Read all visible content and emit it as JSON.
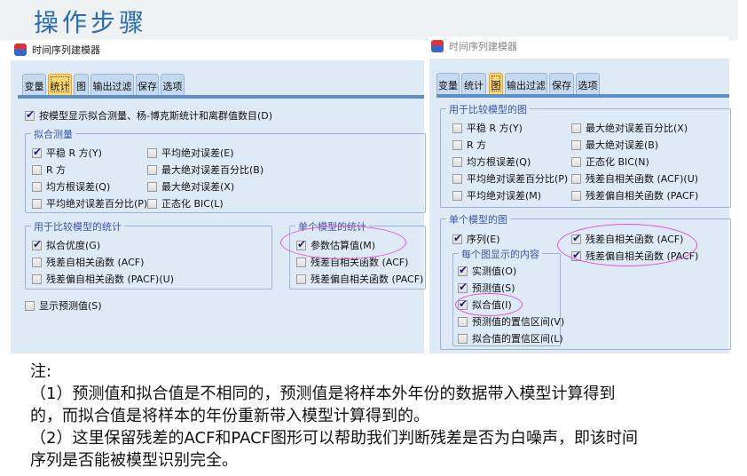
{
  "heading": "操作步骤",
  "left": {
    "window_title": "时间序列建模器",
    "tabs": [
      "变量",
      "统计",
      "图",
      "输出过滤",
      "保存",
      "选项"
    ],
    "active_tab": "统计",
    "display_fit": {
      "label": "按模型显示拟合测量、杨-博克斯统计和离群值数目(D)",
      "checked": true
    },
    "fit_group": {
      "legend": "拟合测量",
      "items": [
        {
          "label": "平稳 R 方(Y)",
          "checked": true
        },
        {
          "label": "R 方",
          "checked": false
        },
        {
          "label": "均方根误差(Q)",
          "checked": false
        },
        {
          "label": "平均绝对误差百分比(P)",
          "checked": false
        },
        {
          "label": "平均绝对误差(E)",
          "checked": false
        },
        {
          "label": "最大绝对误差百分比(B)",
          "checked": false
        },
        {
          "label": "最大绝对误差(X)",
          "checked": false
        },
        {
          "label": "正态化 BIC(L)",
          "checked": false
        }
      ]
    },
    "compare_group": {
      "legend": "用于比较模型的统计",
      "items": [
        {
          "label": "拟合优度(G)",
          "checked": true
        },
        {
          "label": "残差自相关函数 (ACF)",
          "checked": false
        },
        {
          "label": "残差偏自相关函数 (PACF)(U)",
          "checked": false
        }
      ]
    },
    "single_group": {
      "legend": "单个模型的统计",
      "items": [
        {
          "label": "参数估算值(M)",
          "checked": true
        },
        {
          "label": "残差自相关函数 (ACF)",
          "checked": false
        },
        {
          "label": "残差偏自相关函数 (PACF)",
          "checked": false
        }
      ]
    },
    "show_forecast": {
      "label": "显示预测值(S)",
      "checked": false
    }
  },
  "right": {
    "window_title": "时间序列建模器",
    "tabs": [
      "变量",
      "统计",
      "图",
      "输出过滤",
      "保存",
      "选项"
    ],
    "active_tab": "图",
    "compare_group": {
      "legend": "用于比较模型的图",
      "items": [
        {
          "label": "平稳 R 方(Y)",
          "checked": false
        },
        {
          "label": "R 方",
          "checked": false
        },
        {
          "label": "均方根误差(Q)",
          "checked": false
        },
        {
          "label": "平均绝对误差百分比(P)",
          "checked": false
        },
        {
          "label": "平均绝对误差(M)",
          "checked": false
        },
        {
          "label": "最大绝对误差百分比(X)",
          "checked": false
        },
        {
          "label": "最大绝对误差(B)",
          "checked": false
        },
        {
          "label": "正态化 BIC(N)",
          "checked": false
        },
        {
          "label": "残差自相关函数 (ACF)(U)",
          "checked": false
        },
        {
          "label": "残差偏自相关函数 (PACF)",
          "checked": false
        }
      ]
    },
    "single_group": {
      "legend": "单个模型的图",
      "series": {
        "label": "序列(E)",
        "checked": true
      },
      "residual_items": [
        {
          "label": "残差自相关函数 (ACF)",
          "checked": true
        },
        {
          "label": "残差偏自相关函数 (PACF)",
          "checked": true
        }
      ],
      "content_group": {
        "legend": "每个图显示的内容",
        "items": [
          {
            "label": "实测值(O)",
            "checked": true
          },
          {
            "label": "预测值(S)",
            "checked": true
          },
          {
            "label": "拟合值(I)",
            "checked": true
          },
          {
            "label": "预测值的置信区间(V)",
            "checked": false
          },
          {
            "label": "拟合值的置信区间(L)",
            "checked": false
          }
        ]
      }
    }
  },
  "notes": {
    "title": "注:",
    "lines": [
      "（1）预测值和拟合值是不相同的，预测值是将样本外年份的数据带入模型计算得到",
      "的，而拟合值是将样本的年份重新带入模型计算得到的。",
      "（2）这里保留残差的ACF和PACF图形可以帮助我们判断残差是否为白噪声，即该时间",
      "序列是否能被模型识别完全。"
    ]
  },
  "colors": {
    "accent": "#2a6db0",
    "highlight": "#e050d8",
    "panel": "#dfeaf7"
  }
}
